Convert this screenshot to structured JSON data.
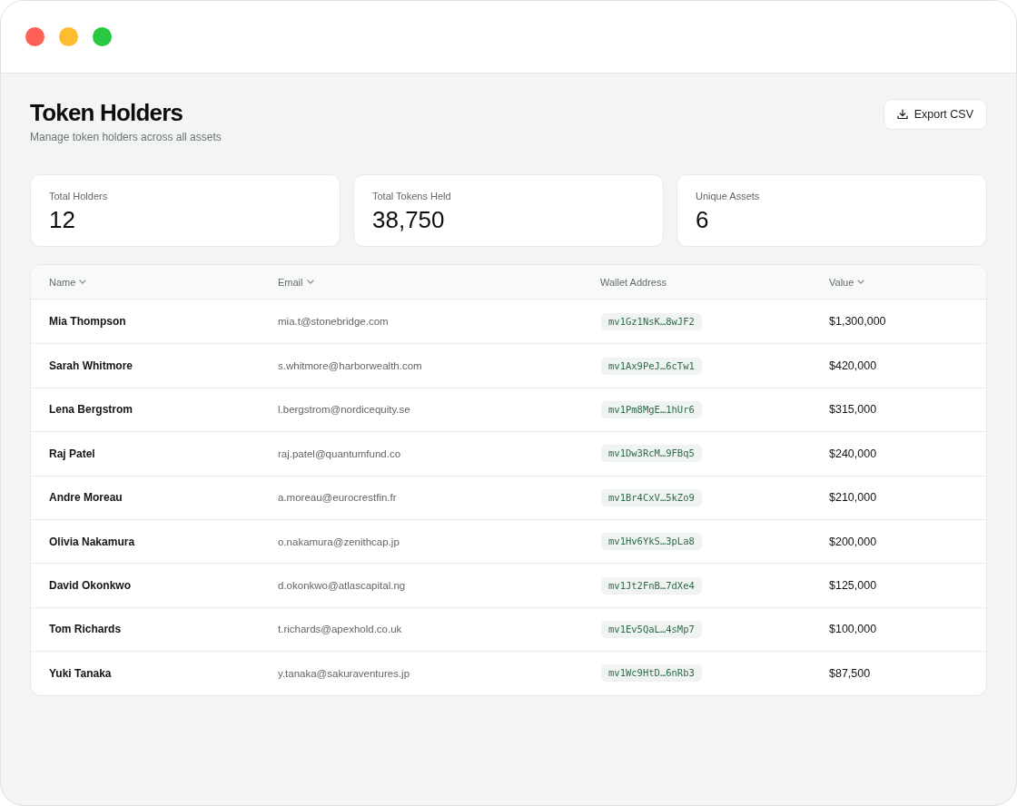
{
  "page": {
    "title": "Token Holders",
    "subtitle": "Manage token holders across all assets",
    "export_button": "Export CSV"
  },
  "stats": [
    {
      "label": "Total Holders",
      "value": "12"
    },
    {
      "label": "Total Tokens Held",
      "value": "38,750"
    },
    {
      "label": "Unique Assets",
      "value": "6"
    }
  ],
  "table": {
    "columns": [
      {
        "label": "Name",
        "sortable": true
      },
      {
        "label": "Email",
        "sortable": true
      },
      {
        "label": "Wallet Address",
        "sortable": false
      },
      {
        "label": "Value",
        "sortable": true
      }
    ],
    "rows": [
      {
        "name": "Mia Thompson",
        "email": "mia.t@stonebridge.com",
        "wallet": "mv1Gz1NsK…8wJF2",
        "value": "$1,300,000"
      },
      {
        "name": "Sarah Whitmore",
        "email": "s.whitmore@harborwealth.com",
        "wallet": "mv1Ax9PeJ…6cTw1",
        "value": "$420,000"
      },
      {
        "name": "Lena Bergstrom",
        "email": "l.bergstrom@nordicequity.se",
        "wallet": "mv1Pm8MgE…1hUr6",
        "value": "$315,000"
      },
      {
        "name": "Raj Patel",
        "email": "raj.patel@quantumfund.co",
        "wallet": "mv1Dw3RcM…9FBq5",
        "value": "$240,000"
      },
      {
        "name": "Andre Moreau",
        "email": "a.moreau@eurocrestfin.fr",
        "wallet": "mv1Br4CxV…5kZo9",
        "value": "$210,000"
      },
      {
        "name": "Olivia Nakamura",
        "email": "o.nakamura@zenithcap.jp",
        "wallet": "mv1Hv6YkS…3pLa8",
        "value": "$200,000"
      },
      {
        "name": "David Okonkwo",
        "email": "d.okonkwo@atlascapital.ng",
        "wallet": "mv1Jt2FnB…7dXe4",
        "value": "$125,000"
      },
      {
        "name": "Tom Richards",
        "email": "t.richards@apexhold.co.uk",
        "wallet": "mv1Ev5QaL…4sMp7",
        "value": "$100,000"
      },
      {
        "name": "Yuki Tanaka",
        "email": "y.tanaka@sakuraventures.jp",
        "wallet": "mv1Wc9HtD…6nRb3",
        "value": "$87,500"
      }
    ]
  }
}
